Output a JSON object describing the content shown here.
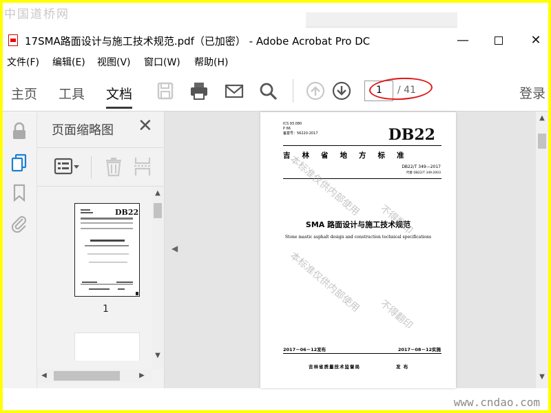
{
  "watermarks": {
    "top_left": "中国道桥网",
    "bottom_right": "www.cndao.com"
  },
  "window": {
    "title": "17SMA路面设计与施工技术规范.pdf（已加密） - Adobe Acrobat Pro DC",
    "controls": {
      "minimize": "—",
      "close": "✕"
    }
  },
  "menu": {
    "items": [
      "文件(F)",
      "编辑(E)",
      "视图(V)",
      "窗口(W)",
      "帮助(H)"
    ]
  },
  "toolbar": {
    "tabs": [
      "主页",
      "工具",
      "文档"
    ],
    "active_tab": "文档",
    "page_current": "1",
    "page_total": "/ 41",
    "login": "登录",
    "colors": {
      "annotation": "#e01818",
      "accent": "#3a3a3a"
    }
  },
  "thumbnails": {
    "title": "页面缩略图",
    "items": [
      {
        "label": "1"
      }
    ]
  },
  "document_page": {
    "ics": "ICS  93.080",
    "p": "P 66",
    "record": "备案号：56220-2017",
    "db": "DB22",
    "standard_line": "吉林省地方标准",
    "code": "DB22/T 349—2017",
    "replaces": "代替 DB22/T 349-2003",
    "title_cn": "SMA 路面设计与施工技术规范",
    "title_en": "Stone mastic asphalt design and construction technical specifications",
    "published": "2017－06－12发布",
    "implemented": "2017－08－12实施",
    "issuer": "吉林省质量技术监督局",
    "issue": "发  布",
    "wm1": "本标准仅供内部使用",
    "wm2": "不得翻印"
  }
}
